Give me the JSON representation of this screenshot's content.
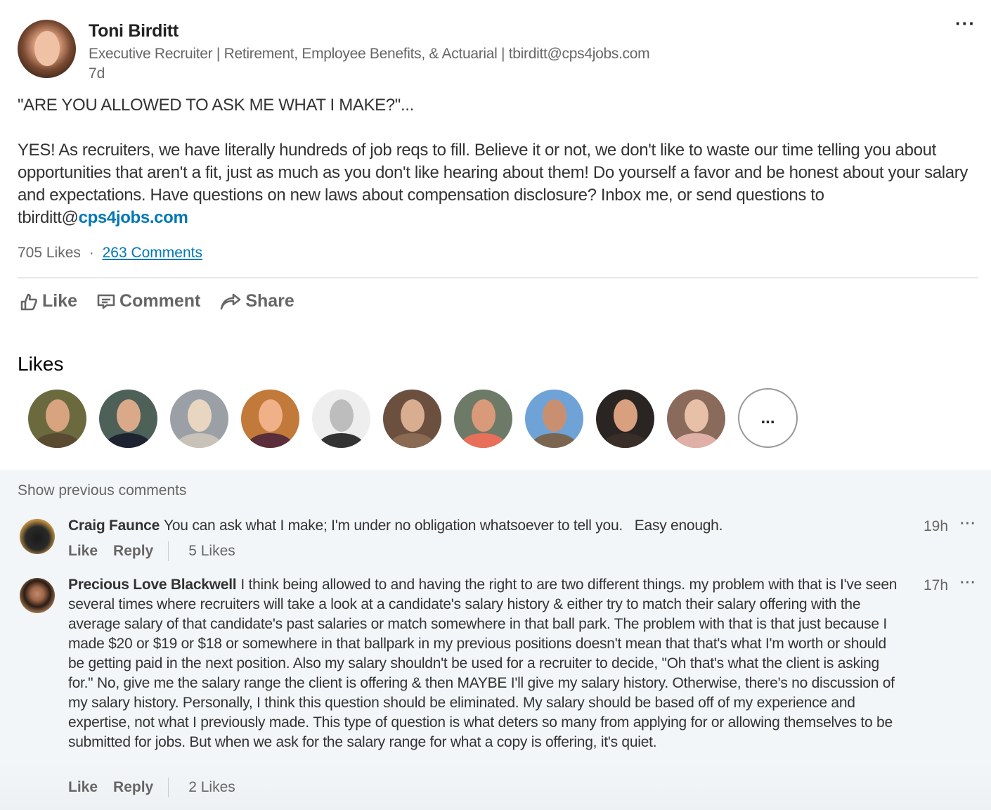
{
  "post": {
    "author": {
      "name": "Toni Birditt",
      "headline": "Executive Recruiter | Retirement, Employee Benefits, & Actuarial | tbirditt@cps4jobs.com",
      "time": "7d",
      "avatar_icon": "profile-photo"
    },
    "menu_label": "···",
    "body": {
      "title": "\"ARE YOU ALLOWED TO ASK ME WHAT I MAKE?\"...",
      "text": "YES! As recruiters, we have literally hundreds of job reqs to fill. Believe it or not, we don't like to waste our time telling you about opportunities that aren't a fit, just as much as you don't like hearing about them! Do yourself a favor and be honest about your salary and expectations. Have questions on new laws about compensation disclosure? Inbox me, or send questions to tbirditt@",
      "link_text": "cps4jobs.com"
    },
    "social_counts": {
      "likes": "705 Likes",
      "separator": "·",
      "comments": "263 Comments"
    },
    "actions": [
      {
        "label": "Like",
        "icon": "thumbs-up-icon"
      },
      {
        "label": "Comment",
        "icon": "comment-icon"
      },
      {
        "label": "Share",
        "icon": "share-icon"
      }
    ]
  },
  "likes_section": {
    "heading": "Likes",
    "likers": [
      {
        "name": "liker-1"
      },
      {
        "name": "liker-2"
      },
      {
        "name": "liker-3"
      },
      {
        "name": "liker-4"
      },
      {
        "name": "liker-5"
      },
      {
        "name": "liker-6"
      },
      {
        "name": "liker-7"
      },
      {
        "name": "liker-8"
      },
      {
        "name": "liker-9"
      },
      {
        "name": "liker-10"
      }
    ],
    "more_label": "..."
  },
  "comments": {
    "show_previous": "Show previous comments",
    "items": [
      {
        "author": "Craig Faunce",
        "text": "You can ask what I make; I'm under no obligation whatsoever to tell you.   Easy enough.",
        "time": "19h",
        "menu": "···",
        "like_label": "Like",
        "reply_label": "Reply",
        "likes": "5 Likes"
      },
      {
        "author": "Precious Love Blackwell",
        "text": "I think being allowed to and having the right to are two different things. my problem with that is I've seen several times where recruiters will take a look at a candidate's salary history & either try to match their salary offering with the average salary of that candidate's past salaries or match somewhere in that ball park. The problem with that is that just because I made $20 or $19 or $18 or somewhere in that ballpark in my previous positions doesn't mean that that's what I'm worth or should be getting paid in the next position. Also my salary shouldn't be used for a recruiter to decide, \"Oh that's what the client is asking for.\" No, give me the salary range the client is offering & then MAYBE I'll give my salary history. Otherwise, there's no discussion of my salary history. Personally, I think this question should be eliminated. My salary should be based off of my experience and expertise, not what I previously made. This type of question is what deters so many from applying for or allowing themselves to be submitted for jobs. But when we ask for the salary range for what a copy is offering, it's quiet.",
        "time": "17h",
        "menu": "···",
        "like_label": "Like",
        "reply_label": "Reply",
        "likes": "2 Likes"
      }
    ]
  },
  "colors": {
    "link": "#0077b5",
    "text_primary": "#333333",
    "text_secondary": "#666666",
    "comments_bg": "#f3f6f8",
    "divider": "#e6e9ec"
  }
}
